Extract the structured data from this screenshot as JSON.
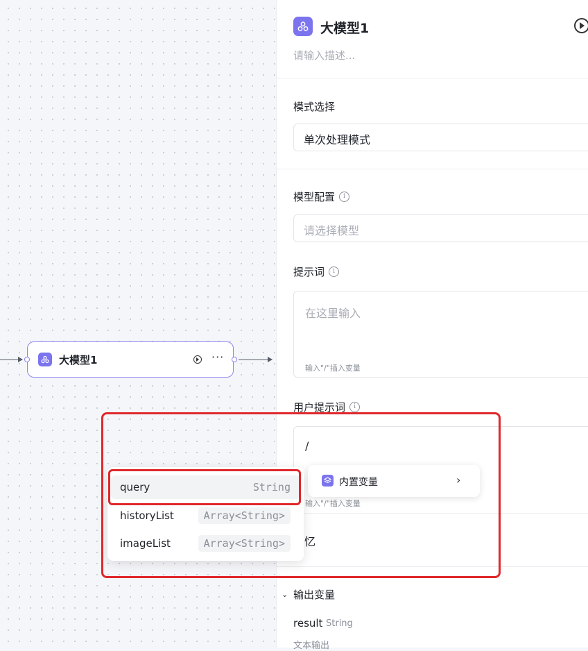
{
  "node": {
    "title": "大模型1",
    "more": "···"
  },
  "variable_menu": {
    "items": [
      {
        "name": "query",
        "type": "String"
      },
      {
        "name": "historyList",
        "type": "Array<String>"
      },
      {
        "name": "imageList",
        "type": "Array<String>"
      }
    ]
  },
  "builtin_menu": {
    "label": "内置变量",
    "chevron": "›"
  },
  "panel": {
    "title": "大模型1",
    "description_placeholder": "请输入描述...",
    "mode_label": "模式选择",
    "mode_value": "单次处理模式",
    "model_config_label": "模型配置",
    "model_placeholder": "请选择模型",
    "prompt_label": "提示词",
    "prompt_placeholder": "在这里输入",
    "prompt_hint": "输入\"/\"插入变量",
    "user_prompt_label": "用户提示词",
    "user_prompt_value": "/",
    "user_prompt_hint": "输入\"/\"插入变量",
    "memory_text": "忆",
    "output_label": "输出变量",
    "output_chevron": "⌄",
    "result_name": "result",
    "result_type": "String",
    "result_desc": "文本输出"
  },
  "colors": {
    "accent": "#7b74ee",
    "highlight": "#e0272b"
  }
}
